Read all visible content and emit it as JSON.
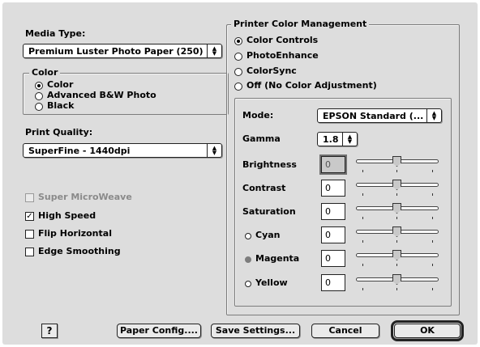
{
  "media_type": {
    "label": "Media Type:",
    "value": "Premium Luster Photo Paper (250)"
  },
  "color_group": {
    "title": "Color",
    "options": [
      "Color",
      "Advanced B&W Photo",
      "Black"
    ],
    "selected": "Color"
  },
  "print_quality": {
    "label": "Print Quality:",
    "value": "SuperFine - 1440dpi"
  },
  "checks": {
    "super_microweave": "Super MicroWeave",
    "high_speed": "High Speed",
    "flip_horizontal": "Flip Horizontal",
    "edge_smoothing": "Edge Smoothing",
    "high_speed_checked": true
  },
  "pcm": {
    "title": "Printer Color Management",
    "options": [
      "Color Controls",
      "PhotoEnhance",
      "ColorSync",
      "Off (No Color Adjustment)"
    ],
    "selected": "Color Controls"
  },
  "controls": {
    "mode_label": "Mode:",
    "mode_value": "EPSON Standard (...",
    "gamma_label": "Gamma",
    "gamma_value": "1.8",
    "rows": [
      {
        "label": "Brightness",
        "value": "0"
      },
      {
        "label": "Contrast",
        "value": "0"
      },
      {
        "label": "Saturation",
        "value": "0"
      },
      {
        "label": "Cyan",
        "value": "0"
      },
      {
        "label": "Magenta",
        "value": "0"
      },
      {
        "label": "Yellow",
        "value": "0"
      }
    ]
  },
  "buttons": {
    "help": "?",
    "paper_config": "Paper Config....",
    "save_settings": "Save Settings...",
    "cancel": "Cancel",
    "ok": "OK"
  }
}
